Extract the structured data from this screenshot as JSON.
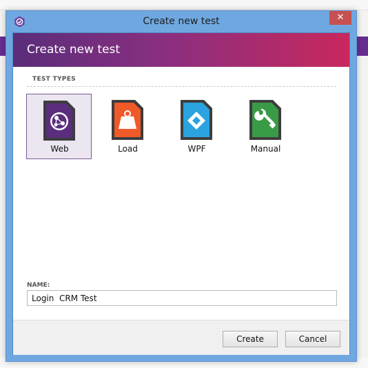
{
  "window": {
    "title": "Create new test",
    "close_glyph": "✕"
  },
  "header": {
    "title": "Create new test"
  },
  "test_types": {
    "label": "TEST TYPES",
    "items": [
      {
        "label": "Web",
        "icon": "web-globe-icon",
        "color": "#5b2d7e",
        "selected": true
      },
      {
        "label": "Load",
        "icon": "load-weight-icon",
        "color": "#f05a28",
        "selected": false
      },
      {
        "label": "WPF",
        "icon": "wpf-diamond-icon",
        "color": "#2aa3df",
        "selected": false
      },
      {
        "label": "Manual",
        "icon": "manual-wrench-icon",
        "color": "#3a9b47",
        "selected": false
      }
    ]
  },
  "name": {
    "label": "NAME:",
    "value": "Login  CRM Test"
  },
  "footer": {
    "create_label": "Create",
    "cancel_label": "Cancel"
  },
  "colors": {
    "accent": "#662d91",
    "header_start": "#5a2d7a",
    "header_end": "#c8285c"
  }
}
